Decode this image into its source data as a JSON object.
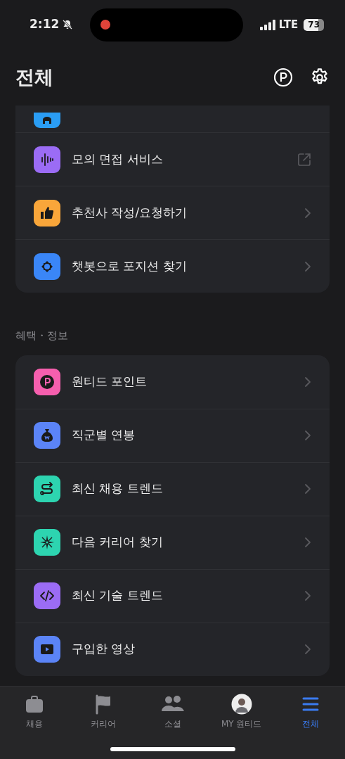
{
  "status_bar": {
    "time": "2:12",
    "network": "LTE",
    "battery": "73"
  },
  "header": {
    "title": "전체"
  },
  "sections": [
    {
      "items": [
        {
          "label": "모의 면접 서비스",
          "kind": "external"
        },
        {
          "label": "추천사 작성/요청하기",
          "kind": "chevron"
        },
        {
          "label": "챗봇으로 포지션 찾기",
          "kind": "chevron"
        }
      ]
    },
    {
      "title": "혜택・정보",
      "items": [
        {
          "label": "원티드 포인트",
          "kind": "chevron"
        },
        {
          "label": "직군별 연봉",
          "kind": "chevron"
        },
        {
          "label": "최신 채용 트렌드",
          "kind": "chevron"
        },
        {
          "label": "다음 커리어 찾기",
          "kind": "chevron"
        },
        {
          "label": "최신 기술 트렌드",
          "kind": "chevron"
        },
        {
          "label": "구입한 영상",
          "kind": "chevron"
        }
      ]
    }
  ],
  "tab_bar": [
    {
      "label": "채용",
      "selected": false
    },
    {
      "label": "커리어",
      "selected": false
    },
    {
      "label": "소셜",
      "selected": false
    },
    {
      "label": "MY 원티드",
      "selected": false
    },
    {
      "label": "전체",
      "selected": true
    }
  ]
}
